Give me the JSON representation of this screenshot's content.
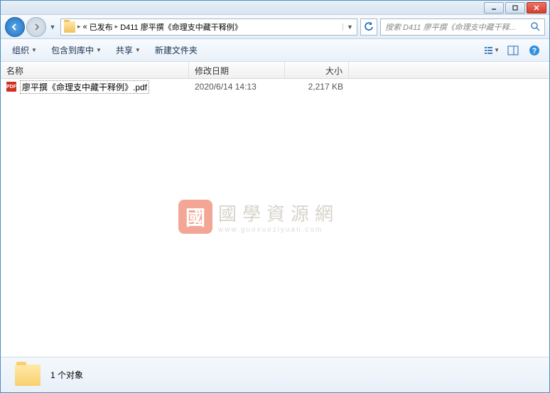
{
  "breadcrumb": {
    "prefix": "«",
    "parts": [
      "已发布",
      "D411 廖平撰《命理支中藏干释例》"
    ]
  },
  "search": {
    "placeholder": "搜索 D411 廖平撰《命理支中藏干释..."
  },
  "toolbar": {
    "organize": "组织",
    "include": "包含到库中",
    "share": "共享",
    "newfolder": "新建文件夹"
  },
  "columns": {
    "name": "名称",
    "date": "修改日期",
    "size": "大小"
  },
  "files": [
    {
      "icon": "PDF",
      "name": "廖平撰《命理支中藏干释例》.pdf",
      "date": "2020/6/14 14:13",
      "size": "2,217 KB"
    }
  ],
  "watermark": {
    "icon": "國",
    "zh": "國學資源網",
    "en": "www.guoxueziyuan.com"
  },
  "status": {
    "count": "1 个对象"
  }
}
